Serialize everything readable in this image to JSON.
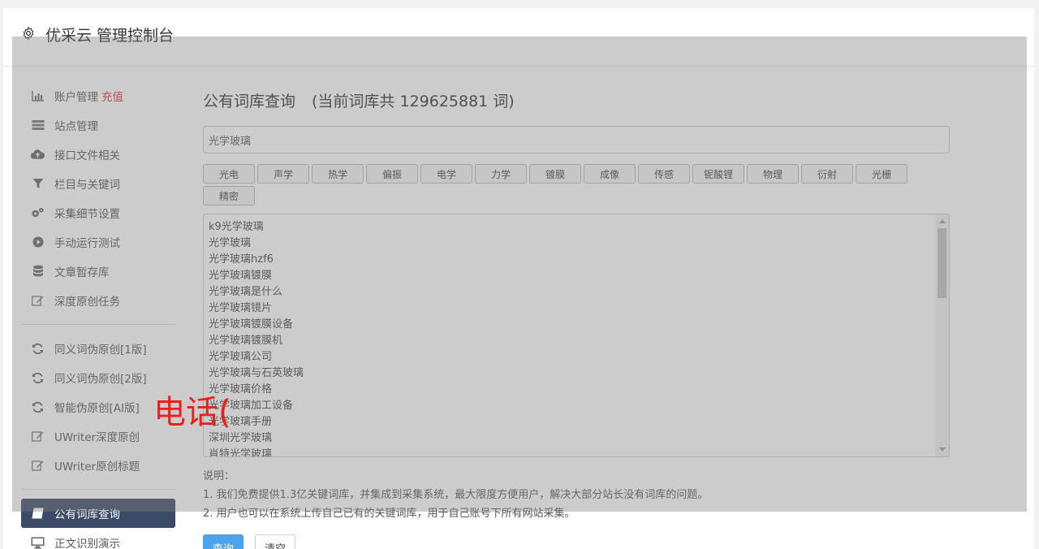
{
  "header": {
    "title": "优采云 管理控制台"
  },
  "sidebar": {
    "group1": [
      {
        "label": "账户管理",
        "badge": "充值",
        "icon": "bar-chart-icon"
      },
      {
        "label": "站点管理",
        "icon": "server-icon"
      },
      {
        "label": "接口文件相关",
        "icon": "cloud-upload-icon"
      },
      {
        "label": "栏目与关键词",
        "icon": "filter-icon"
      },
      {
        "label": "采集细节设置",
        "icon": "gears-icon"
      },
      {
        "label": "手动运行测试",
        "icon": "play-circle-icon"
      },
      {
        "label": "文章暂存库",
        "icon": "database-icon"
      },
      {
        "label": "深度原创任务",
        "icon": "edit-icon"
      }
    ],
    "group2": [
      {
        "label": "同义词伪原创[1版]",
        "icon": "refresh-icon"
      },
      {
        "label": "同义词伪原创[2版]",
        "icon": "refresh-icon"
      },
      {
        "label": "智能伪原创[AI版]",
        "icon": "refresh-icon"
      },
      {
        "label": "UWriter深度原创",
        "icon": "edit-icon"
      },
      {
        "label": "UWriter原创标题",
        "icon": "edit-icon"
      }
    ],
    "group3": [
      {
        "label": "公有词库查询",
        "icon": "book-icon",
        "active": true
      },
      {
        "label": "正文识别演示",
        "icon": "monitor-icon"
      }
    ]
  },
  "main": {
    "title": "公有词库查询",
    "count_text": "(当前词库共 129625881 词)",
    "search_value": "光学玻璃",
    "tags": [
      "光电",
      "声学",
      "热学",
      "偏振",
      "电学",
      "力学",
      "镀膜",
      "成像",
      "传感",
      "铌酸锂",
      "物理",
      "衍射",
      "光栅",
      "精密"
    ],
    "results": [
      "k9光学玻璃",
      "光学玻璃",
      "光学玻璃hzf6",
      "光学玻璃镀膜",
      "光学玻璃是什么",
      "光学玻璃镜片",
      "光学玻璃镀膜设备",
      "光学玻璃镀膜机",
      "光学玻璃公司",
      "光学玻璃与石英玻璃",
      "光学玻璃价格",
      "光学玻璃加工设备",
      "光学玻璃手册",
      "深圳光学玻璃",
      "肖特光学玻璃"
    ],
    "notes_title": "说明：",
    "notes": [
      "1. 我们免费提供1.3亿关键词库，并集成到采集系统，最大限度方便用户，解决大部分站长没有词库的问题。",
      "2. 用户也可以在系统上传自己已有的关键词库，用于自己账号下所有网站采集。"
    ],
    "query_button": "查询",
    "clear_button": "清空"
  },
  "overlay_text": "电话(",
  "colors": {
    "active_bg": "#3a4a67",
    "primary": "#4aa3ef",
    "badge": "#e0312f",
    "overlay_text": "#e8221a"
  }
}
